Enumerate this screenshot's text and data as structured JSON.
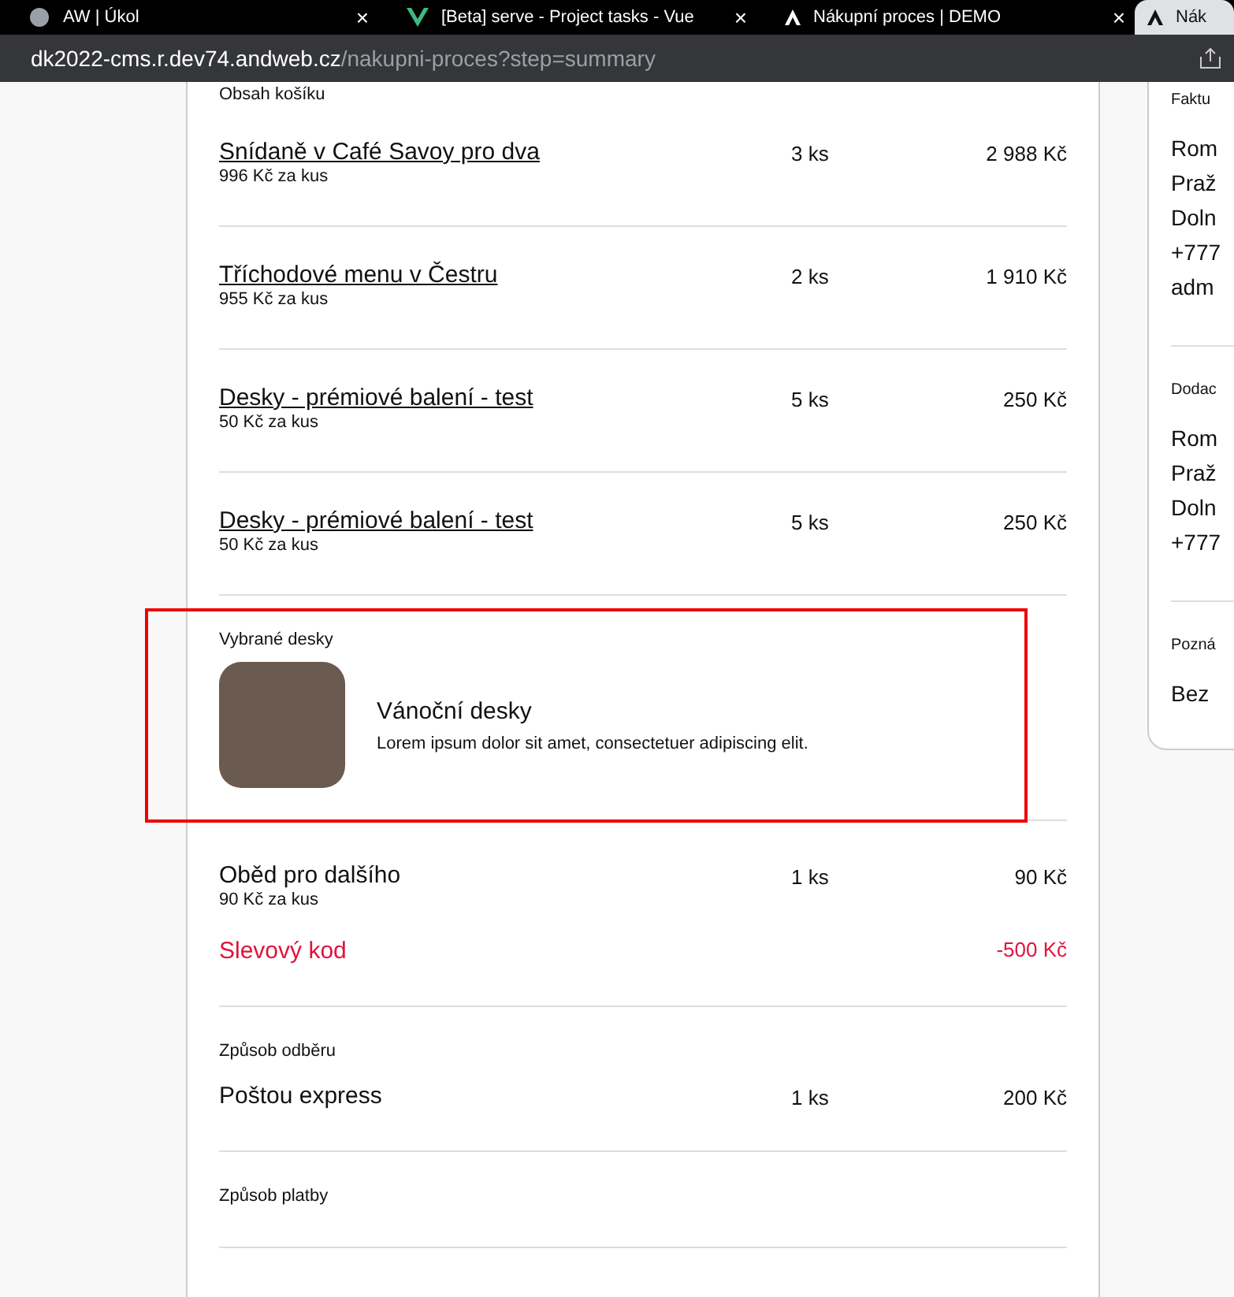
{
  "browser": {
    "tabs": [
      {
        "title": "AW | Úkol",
        "kind": "globe",
        "close": "×",
        "selected": false
      },
      {
        "title": "[Beta] serve - Project tasks - Vue",
        "kind": "vue",
        "close": "×",
        "selected": false
      },
      {
        "title": "Nákupní proces | DEMO",
        "kind": "letter",
        "close": "×",
        "selected": false
      },
      {
        "title": "Nák",
        "kind": "letter",
        "selected": true
      }
    ],
    "address": {
      "host": "dk2022-cms.r.dev74.andweb.cz",
      "path": "/nakupni-proces?step=summary"
    }
  },
  "cart": {
    "heading": "Obsah košíku",
    "items": [
      {
        "name": "Snídaně v Café Savoy pro dva",
        "unit_price": "996 Kč za kus",
        "qty": "3 ks",
        "total": "2 988 Kč",
        "kind": "link"
      },
      {
        "name": "Tříchodové menu v Čestru",
        "unit_price": "955 Kč za kus",
        "qty": "2 ks",
        "total": "1 910 Kč",
        "kind": "link"
      },
      {
        "name": "Desky - prémiové balení - test",
        "unit_price": "50 Kč za kus",
        "qty": "5 ks",
        "total": "250 Kč",
        "kind": "link"
      },
      {
        "name": "Desky - prémiové balení - test",
        "unit_price": "50 Kč za kus",
        "qty": "5 ks",
        "total": "250 Kč",
        "kind": "link"
      }
    ],
    "selected_boards": {
      "heading": "Vybrané desky",
      "title": "Vánoční desky",
      "description": "Lorem ipsum dolor sit amet, consectetuer adipiscing elit.",
      "highlighted": true
    },
    "extra_items": [
      {
        "name": "Oběd pro dalšího",
        "unit_price": "90 Kč za kus",
        "qty": "1 ks",
        "total": "90 Kč",
        "kind": "plain"
      }
    ],
    "discount": {
      "label": "Slevový kod",
      "amount": "-500 Kč"
    },
    "shipping": {
      "heading": "Způsob odběru",
      "name": "Poštou express",
      "qty": "1 ks",
      "price": "200 Kč"
    },
    "payment": {
      "heading": "Způsob platby"
    }
  },
  "side": {
    "sections": [
      {
        "heading": "Faktu",
        "lines": [
          "Rom",
          "Praž",
          "Doln",
          "+777",
          "adm"
        ]
      },
      {
        "heading": "Dodac",
        "lines": [
          "Rom",
          "Praž",
          "Doln",
          "+777"
        ]
      },
      {
        "heading": "Pozná",
        "lines": [
          "Bez"
        ]
      }
    ]
  }
}
